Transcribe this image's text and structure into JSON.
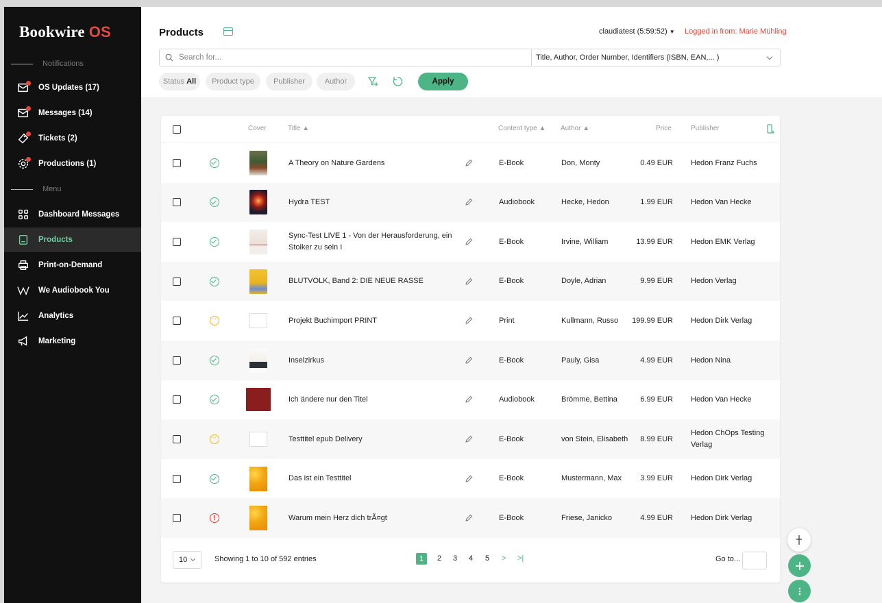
{
  "app": {
    "brand": "Bookwire",
    "brand_os": "OS"
  },
  "sidebar": {
    "notifications_label": "Notifications",
    "menu_label": "Menu",
    "notifications": [
      {
        "label": "OS Updates (17)",
        "icon": "mail-icon"
      },
      {
        "label": "Messages (14)",
        "icon": "mail-icon"
      },
      {
        "label": "Tickets (2)",
        "icon": "ticket-icon"
      },
      {
        "label": "Productions (1)",
        "icon": "gear-icon"
      }
    ],
    "menu": [
      {
        "label": "Dashboard Messages",
        "icon": "grid-icon"
      },
      {
        "label": "Products",
        "icon": "document-icon",
        "active": true
      },
      {
        "label": "Print-on-Demand",
        "icon": "printer-icon"
      },
      {
        "label": "We Audiobook You",
        "icon": "w-icon"
      },
      {
        "label": "Analytics",
        "icon": "chart-icon"
      },
      {
        "label": "Marketing",
        "icon": "megaphone-icon"
      }
    ]
  },
  "header": {
    "title": "Products",
    "session": "claudiatest (5:59:52)",
    "login": "Logged in from: Marie Mühling",
    "search_placeholder": "Search for...",
    "search_scope": "Title, Author, Order Number, Identifiers (ISBN, EAN,... )"
  },
  "filters": {
    "status_label": "Status",
    "status_value": "All",
    "product_type": "Product type",
    "publisher": "Publisher",
    "author": "Author",
    "apply": "Apply"
  },
  "table": {
    "columns": {
      "cover": "Cover",
      "title": "Title",
      "content_type": "Content type",
      "author": "Author",
      "price": "Price",
      "publisher": "Publisher"
    },
    "rows": [
      {
        "status": "ok",
        "cover": "garden",
        "title": "A Theory on Nature Gardens",
        "content_type": "E-Book",
        "author": "Don, Monty",
        "price": "0.49 EUR",
        "publisher": "Hedon Franz Fuchs"
      },
      {
        "status": "ok",
        "cover": "hydra",
        "title": "Hydra TEST",
        "content_type": "Audiobook",
        "author": "Hecke, Hedon",
        "price": "1.99 EUR",
        "publisher": "Hedon Van Hecke"
      },
      {
        "status": "ok",
        "cover": "sync",
        "title": "Sync-Test LIVE 1 - Von der Herausforderung, ein Stoiker zu sein I",
        "content_type": "E-Book",
        "author": "Irvine, William",
        "price": "13.99 EUR",
        "publisher": "Hedon EMK Verlag"
      },
      {
        "status": "ok",
        "cover": "blutvolk",
        "title": "BLUTVOLK, Band 2: DIE NEUE RASSE",
        "content_type": "E-Book",
        "author": "Doyle, Adrian",
        "price": "9.99 EUR",
        "publisher": "Hedon Verlag"
      },
      {
        "status": "wait",
        "cover": "placeholder",
        "title": "Projekt Buchimport PRINT",
        "content_type": "Print",
        "author": "Kullmann, Russo",
        "price": "199.99 EUR",
        "publisher": "Hedon Dirk Verlag"
      },
      {
        "status": "ok",
        "cover": "insel",
        "title": "Inselzirkus",
        "content_type": "E-Book",
        "author": "Pauly, Gisa",
        "price": "4.99 EUR",
        "publisher": "Hedon Nina"
      },
      {
        "status": "ok",
        "cover": "red",
        "title": "Ich ändere nur den Titel",
        "content_type": "Audiobook",
        "author": "Brömme, Bettina",
        "price": "6.99 EUR",
        "publisher": "Hedon Van Hecke"
      },
      {
        "status": "wait",
        "cover": "placeholder",
        "title": "Testtitel epub Delivery",
        "content_type": "E-Book",
        "author": "von Stein, Elisabeth",
        "price": "8.99 EUR",
        "publisher": "Hedon ChOps Testing Verlag"
      },
      {
        "status": "ok",
        "cover": "yellow",
        "title": "Das ist ein Testtitel",
        "content_type": "E-Book",
        "author": "Mustermann, Max",
        "price": "3.99 EUR",
        "publisher": "Hedon Dirk Verlag"
      },
      {
        "status": "err",
        "cover": "yellow",
        "title": "Warum mein Herz dich trÃ¤gt",
        "content_type": "E-Book",
        "author": "Friese, Janicko",
        "price": "4.99 EUR",
        "publisher": "Hedon Dirk Verlag"
      }
    ]
  },
  "pagination": {
    "per_page": "10",
    "summary": "Showing 1 to 10 of 592 entries",
    "pages": [
      "1",
      "2",
      "3",
      "4",
      "5"
    ],
    "current": "1",
    "next": ">",
    "last": ">|",
    "goto_label": "Go to..."
  },
  "colors": {
    "accent": "#4db585",
    "danger": "#e5483c",
    "warning": "#f2b51b",
    "sidebar_bg": "#111111"
  }
}
